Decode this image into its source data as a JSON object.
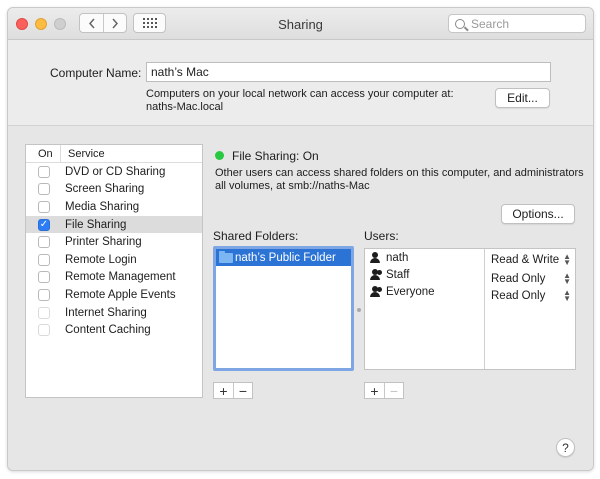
{
  "window": {
    "title": "Sharing"
  },
  "toolbar": {
    "back_icon": "chevron-left-icon",
    "forward_icon": "chevron-right-icon",
    "grid_icon": "show-all-grid-icon",
    "search_placeholder": "Search"
  },
  "computer_name": {
    "label": "Computer Name:",
    "value": "nath’s Mac",
    "help_line1": "Computers on your local network can access your computer at:",
    "help_line2": "naths-Mac.local",
    "edit_label": "Edit..."
  },
  "services": {
    "header_on": "On",
    "header_service": "Service",
    "items": [
      {
        "label": "DVD or CD Sharing",
        "checked": false,
        "selected": false
      },
      {
        "label": "Screen Sharing",
        "checked": false,
        "selected": false
      },
      {
        "label": "Media Sharing",
        "checked": false,
        "selected": false
      },
      {
        "label": "File Sharing",
        "checked": true,
        "selected": true
      },
      {
        "label": "Printer Sharing",
        "checked": false,
        "selected": false
      },
      {
        "label": "Remote Login",
        "checked": false,
        "selected": false
      },
      {
        "label": "Remote Management",
        "checked": false,
        "selected": false
      },
      {
        "label": "Remote Apple Events",
        "checked": false,
        "selected": false
      },
      {
        "label": "Internet Sharing",
        "checked": false,
        "selected": false
      },
      {
        "label": "Content Caching",
        "checked": false,
        "selected": false
      }
    ]
  },
  "file_sharing": {
    "status": "File Sharing: On",
    "status_color": "#28c840",
    "description_line1": "Other users can access shared folders on this computer, and administrators",
    "description_line2": "all volumes, at smb://naths-Mac",
    "options_label": "Options...",
    "shared_folders_label": "Shared Folders:",
    "shared_folders": [
      "nath’s Public Folder"
    ],
    "users_label": "Users:",
    "users": [
      {
        "name": "nath",
        "icon": "user-icon",
        "permission": "Read & Write"
      },
      {
        "name": "Staff",
        "icon": "group-icon",
        "permission": "Read Only"
      },
      {
        "name": "Everyone",
        "icon": "everyone-icon",
        "permission": "Read Only"
      }
    ]
  },
  "controls": {
    "plus": "+",
    "minus": "−",
    "help": "?"
  },
  "colors": {
    "accent": "#2c73d6",
    "checkbox_checked": "#2c7cf6"
  }
}
